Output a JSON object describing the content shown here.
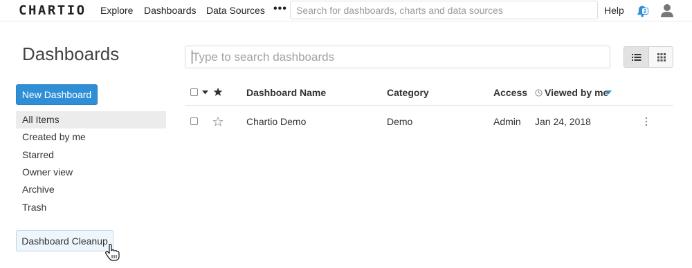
{
  "topbar": {
    "logo": "CHARTIO",
    "nav": [
      "Explore",
      "Dashboards",
      "Data Sources"
    ],
    "more": "•••",
    "search_placeholder": "Search for dashboards, charts and data sources",
    "help": "Help",
    "notification_count": "2"
  },
  "page": {
    "title": "Dashboards",
    "new_button": "New Dashboard",
    "cleanup_button": "Dashboard Cleanup"
  },
  "sidebar": {
    "items": [
      {
        "label": "All Items",
        "active": true
      },
      {
        "label": "Created by me"
      },
      {
        "label": "Starred"
      },
      {
        "label": "Owner view"
      },
      {
        "label": "Archive"
      },
      {
        "label": "Trash"
      }
    ]
  },
  "main": {
    "search_placeholder": "Type to search dashboards",
    "columns": {
      "name": "Dashboard Name",
      "category": "Category",
      "access": "Access",
      "viewed": "Viewed by me"
    },
    "rows": [
      {
        "name": "Chartio Demo",
        "category": "Demo",
        "access": "Admin",
        "viewed": "Jan 24, 2018",
        "starred": false
      }
    ]
  },
  "colors": {
    "accent": "#2f8fd6",
    "active_item_bg": "#ececec"
  }
}
